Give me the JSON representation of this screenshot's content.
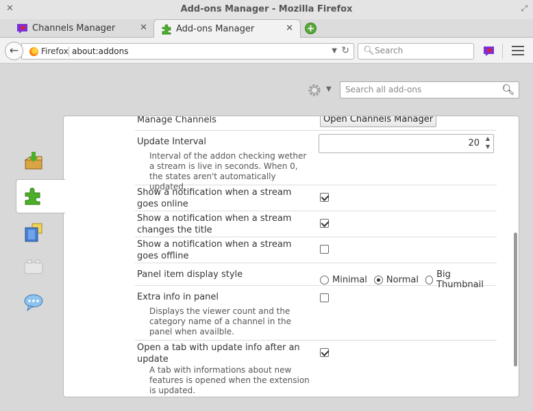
{
  "window": {
    "title": "Add-ons Manager - Mozilla Firefox"
  },
  "tabs": [
    {
      "label": "Channels Manager",
      "active": false
    },
    {
      "label": "Add-ons Manager",
      "active": true
    }
  ],
  "navbar": {
    "identity": "Firefox",
    "url": "about:addons",
    "search_placeholder": "Search"
  },
  "addons": {
    "search_placeholder": "Search all add-ons",
    "categories": [
      {
        "name": "get-addons",
        "icon": "download-box-icon"
      },
      {
        "name": "extensions",
        "icon": "puzzle-icon"
      },
      {
        "name": "appearance",
        "icon": "appearance-icon"
      },
      {
        "name": "plugins",
        "icon": "plugin-block-icon"
      },
      {
        "name": "services",
        "icon": "chat-bubble-icon"
      }
    ]
  },
  "settings": {
    "manage_channels": {
      "label": "Manage Channels",
      "button": "Open Channels Manager"
    },
    "update_interval": {
      "label": "Update Interval",
      "description": "Interval of the addon checking wether a stream is live in seconds. When 0, the states aren't automatically updated.",
      "value": "20"
    },
    "notify_online": {
      "label": "Show a notification when a stream goes online",
      "checked": true
    },
    "notify_title": {
      "label": "Show a notification when a stream changes the title",
      "checked": true
    },
    "notify_offline": {
      "label": "Show a notification when a stream goes offline",
      "checked": false
    },
    "display_style": {
      "label": "Panel item display style",
      "options": [
        "Minimal",
        "Normal",
        "Big Thumbnail"
      ],
      "selected": "Normal"
    },
    "extra_info": {
      "label": "Extra info in panel",
      "description": "Displays the viewer count and the category name of a channel in the panel when availble.",
      "checked": false
    },
    "update_tab": {
      "label": "Open a tab with update info after an update",
      "description": "A tab with informations about new features is opened when the extension is updated.",
      "checked": true
    }
  },
  "colors": {
    "tab_icon_purple": "#7b2fd6",
    "tab_icon_red": "#e02020",
    "addon_green": "#4caf2a"
  }
}
